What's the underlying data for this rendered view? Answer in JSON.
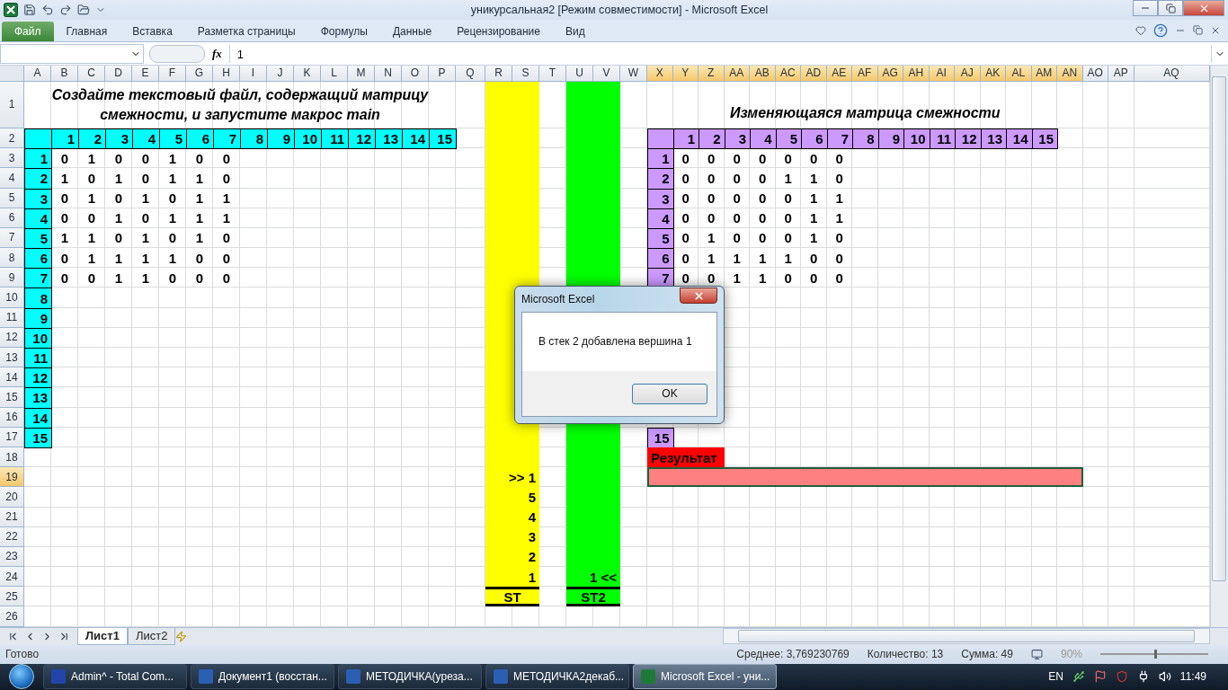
{
  "window": {
    "title": "уникурсальная2  [Режим совместимости]  -  Microsoft Excel"
  },
  "ribbon_tabs": [
    {
      "label": "Файл",
      "selected": true
    },
    {
      "label": "Главная",
      "selected": false
    },
    {
      "label": "Вставка",
      "selected": false
    },
    {
      "label": "Разметка страницы",
      "selected": false
    },
    {
      "label": "Формулы",
      "selected": false
    },
    {
      "label": "Данные",
      "selected": false
    },
    {
      "label": "Рецензирование",
      "selected": false
    },
    {
      "label": "Вид",
      "selected": false
    }
  ],
  "formula_bar": {
    "function_label": "fx",
    "formula": "1"
  },
  "sheet": {
    "columns": [
      {
        "label": "A",
        "selected": false
      },
      {
        "label": "B",
        "selected": false
      },
      {
        "label": "C",
        "selected": false
      },
      {
        "label": "D",
        "selected": false
      },
      {
        "label": "E",
        "selected": false
      },
      {
        "label": "F",
        "selected": false
      },
      {
        "label": "G",
        "selected": false
      },
      {
        "label": "H",
        "selected": false
      },
      {
        "label": "I",
        "selected": false
      },
      {
        "label": "J",
        "selected": false
      },
      {
        "label": "K",
        "selected": false
      },
      {
        "label": "L",
        "selected": false
      },
      {
        "label": "M",
        "selected": false
      },
      {
        "label": "N",
        "selected": false
      },
      {
        "label": "O",
        "selected": false
      },
      {
        "label": "P",
        "selected": false
      },
      {
        "label": "Q",
        "selected": false
      },
      {
        "label": "R",
        "selected": false
      },
      {
        "label": "S",
        "selected": false
      },
      {
        "label": "T",
        "selected": false
      },
      {
        "label": "U",
        "selected": false
      },
      {
        "label": "V",
        "selected": false
      },
      {
        "label": "W",
        "selected": false
      },
      {
        "label": "X",
        "selected": true
      },
      {
        "label": "Y",
        "selected": true
      },
      {
        "label": "Z",
        "selected": true
      },
      {
        "label": "AA",
        "selected": true
      },
      {
        "label": "AB",
        "selected": true
      },
      {
        "label": "AC",
        "selected": true
      },
      {
        "label": "AD",
        "selected": true
      },
      {
        "label": "AE",
        "selected": true
      },
      {
        "label": "AF",
        "selected": true
      },
      {
        "label": "AG",
        "selected": true
      },
      {
        "label": "AH",
        "selected": true
      },
      {
        "label": "AI",
        "selected": true
      },
      {
        "label": "AJ",
        "selected": true
      },
      {
        "label": "AK",
        "selected": true
      },
      {
        "label": "AL",
        "selected": true
      },
      {
        "label": "AM",
        "selected": true
      },
      {
        "label": "AN",
        "selected": true
      },
      {
        "label": "AO",
        "selected": false
      },
      {
        "label": "AP",
        "selected": false
      },
      {
        "label": "AQ",
        "selected": false
      }
    ],
    "rows": [
      {
        "label": "1",
        "selected": false
      },
      {
        "label": "2",
        "selected": false
      },
      {
        "label": "3",
        "selected": false
      },
      {
        "label": "4",
        "selected": false
      },
      {
        "label": "5",
        "selected": false
      },
      {
        "label": "6",
        "selected": false
      },
      {
        "label": "7",
        "selected": false
      },
      {
        "label": "8",
        "selected": false
      },
      {
        "label": "9",
        "selected": false
      },
      {
        "label": "10",
        "selected": false
      },
      {
        "label": "11",
        "selected": false
      },
      {
        "label": "12",
        "selected": false
      },
      {
        "label": "13",
        "selected": false
      },
      {
        "label": "14",
        "selected": false
      },
      {
        "label": "15",
        "selected": false
      },
      {
        "label": "16",
        "selected": false
      },
      {
        "label": "17",
        "selected": false
      },
      {
        "label": "18",
        "selected": false
      },
      {
        "label": "19",
        "selected": true
      },
      {
        "label": "20",
        "selected": false
      },
      {
        "label": "21",
        "selected": false
      },
      {
        "label": "22",
        "selected": false
      },
      {
        "label": "23",
        "selected": false
      },
      {
        "label": "24",
        "selected": false
      },
      {
        "label": "25",
        "selected": false
      },
      {
        "label": "26",
        "selected": false
      }
    ],
    "left_matrix": {
      "title": "Создайте текстовый файл, содержащий матрицу смежности, и запустите макрос main",
      "header": [
        "1",
        "2",
        "3",
        "4",
        "5",
        "6",
        "7",
        "8",
        "9",
        "10",
        "11",
        "12",
        "13",
        "14",
        "15"
      ],
      "row_labels": [
        "1",
        "2",
        "3",
        "4",
        "5",
        "6",
        "7",
        "8",
        "9",
        "10",
        "11",
        "12",
        "13",
        "14",
        "15"
      ],
      "values": [
        [
          "0",
          "1",
          "0",
          "0",
          "1",
          "0",
          "0"
        ],
        [
          "1",
          "0",
          "1",
          "0",
          "1",
          "1",
          "0"
        ],
        [
          "0",
          "1",
          "0",
          "1",
          "0",
          "1",
          "1"
        ],
        [
          "0",
          "0",
          "1",
          "0",
          "1",
          "1",
          "1"
        ],
        [
          "1",
          "1",
          "0",
          "1",
          "0",
          "1",
          "0"
        ],
        [
          "0",
          "1",
          "1",
          "1",
          "1",
          "0",
          "0"
        ],
        [
          "0",
          "0",
          "1",
          "1",
          "0",
          "0",
          "0"
        ]
      ]
    },
    "right_matrix": {
      "title": "Изменяющаяся матрица смежности",
      "header": [
        "1",
        "2",
        "3",
        "4",
        "5",
        "6",
        "7",
        "8",
        "9",
        "10",
        "11",
        "12",
        "13",
        "14",
        "15"
      ],
      "row_labels": [
        "1",
        "2",
        "3",
        "4",
        "5",
        "6",
        "7"
      ],
      "last_label": "15",
      "values": [
        [
          "0",
          "0",
          "0",
          "0",
          "0",
          "0",
          "0"
        ],
        [
          "0",
          "0",
          "0",
          "0",
          "1",
          "1",
          "0"
        ],
        [
          "0",
          "0",
          "0",
          "0",
          "0",
          "1",
          "1"
        ],
        [
          "0",
          "0",
          "0",
          "0",
          "0",
          "1",
          "1"
        ],
        [
          "0",
          "1",
          "0",
          "0",
          "0",
          "1",
          "0"
        ],
        [
          "0",
          "1",
          "1",
          "1",
          "1",
          "0",
          "0"
        ],
        [
          "0",
          "0",
          "1",
          "1",
          "0",
          "0",
          "0"
        ]
      ]
    },
    "stack": {
      "entries": [
        ">> 1",
        "5",
        "4",
        "3",
        "2",
        "1"
      ],
      "label": "ST"
    },
    "stack2": {
      "entries": [
        "1 <<"
      ],
      "label": "ST2"
    },
    "result": {
      "label": "Результат"
    }
  },
  "dialog": {
    "title": "Microsoft Excel",
    "message": "В стек 2 добавлена вершина 1",
    "button": "OK"
  },
  "sheet_tabs": [
    {
      "label": "Лист1",
      "selected": true
    },
    {
      "label": "Лист2",
      "selected": false
    }
  ],
  "status_bar": {
    "ready": "Готово",
    "average": "Среднее: 3,769230769",
    "count": "Количество: 13",
    "sum": "Сумма: 49",
    "zoom": "90%",
    "zoom_slider": {
      "level": 0.5
    }
  },
  "taskbar": {
    "items": [
      {
        "label": "Admin^ - Total Com...",
        "kind": "commander",
        "selected": false
      },
      {
        "label": "Документ1 (восстан...",
        "kind": "word",
        "selected": false
      },
      {
        "label": "МЕТОДИЧКА(уреза...",
        "kind": "word",
        "selected": false
      },
      {
        "label": "МЕТОДИЧКА2декаб...",
        "kind": "word",
        "selected": false
      },
      {
        "label": "Microsoft Excel - уни...",
        "kind": "excel",
        "selected": true
      }
    ],
    "language": "EN",
    "clock": "11:49"
  }
}
